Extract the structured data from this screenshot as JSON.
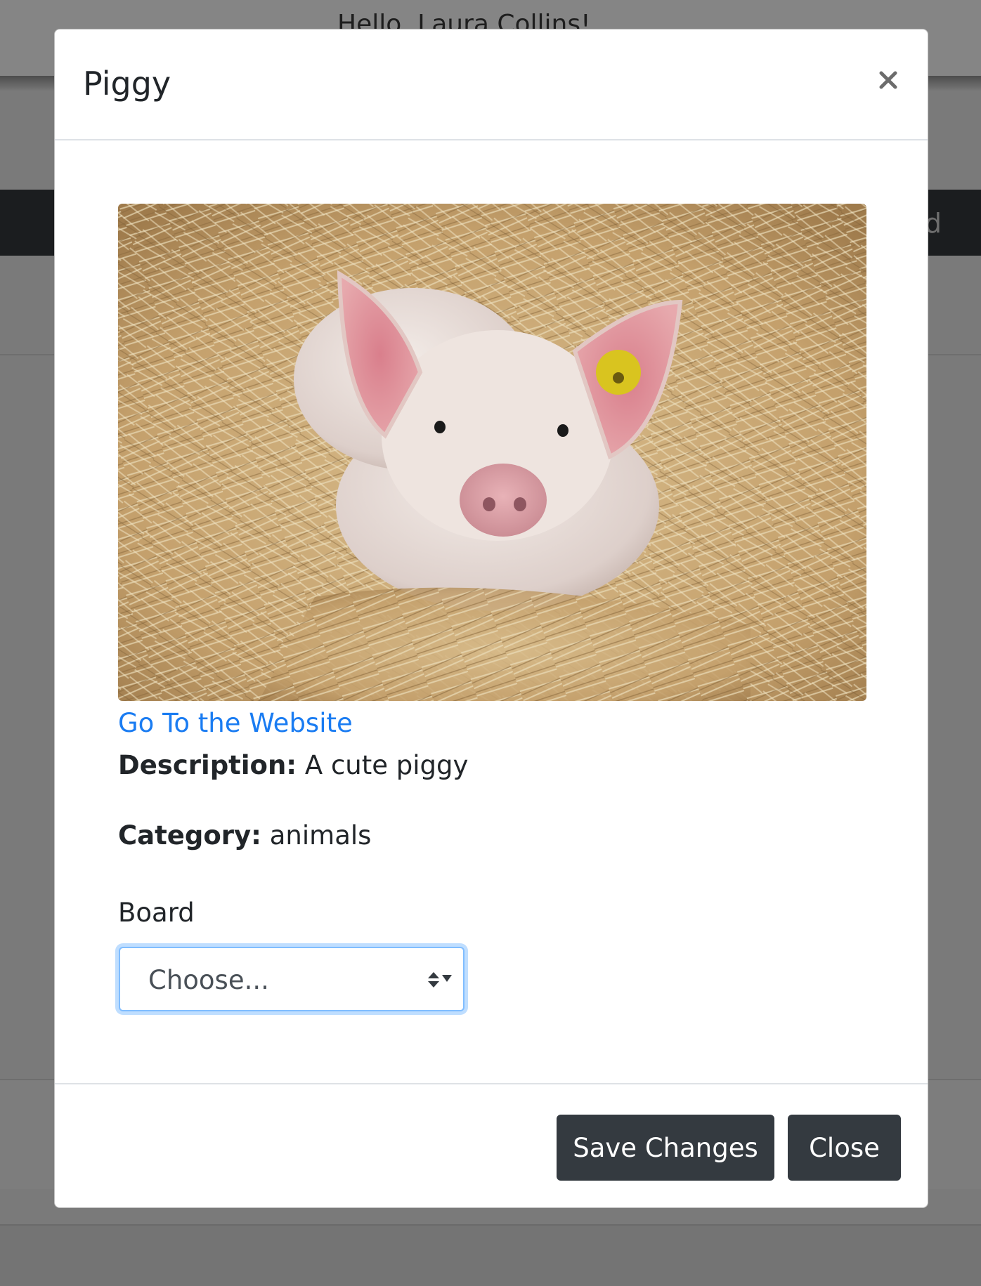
{
  "background": {
    "greeting": "Hello, Laura Collins!",
    "nav_fragment": "d"
  },
  "modal": {
    "title": "Piggy",
    "close_icon": "close-icon",
    "image": {
      "subject": "pig-lying-in-straw-photo"
    },
    "link_text": "Go To the Website",
    "description_label": "Description:",
    "description_value": "A cute piggy",
    "category_label": "Category:",
    "category_value": "animals",
    "board_label": "Board",
    "board_select": {
      "selected": "Choose..."
    },
    "buttons": {
      "save": "Save Changes",
      "close": "Close"
    }
  },
  "colors": {
    "link": "#1a7cf2",
    "button_bg": "#343a40",
    "focus_ring": "#80bdff",
    "backdrop": "#7a7a7a"
  }
}
